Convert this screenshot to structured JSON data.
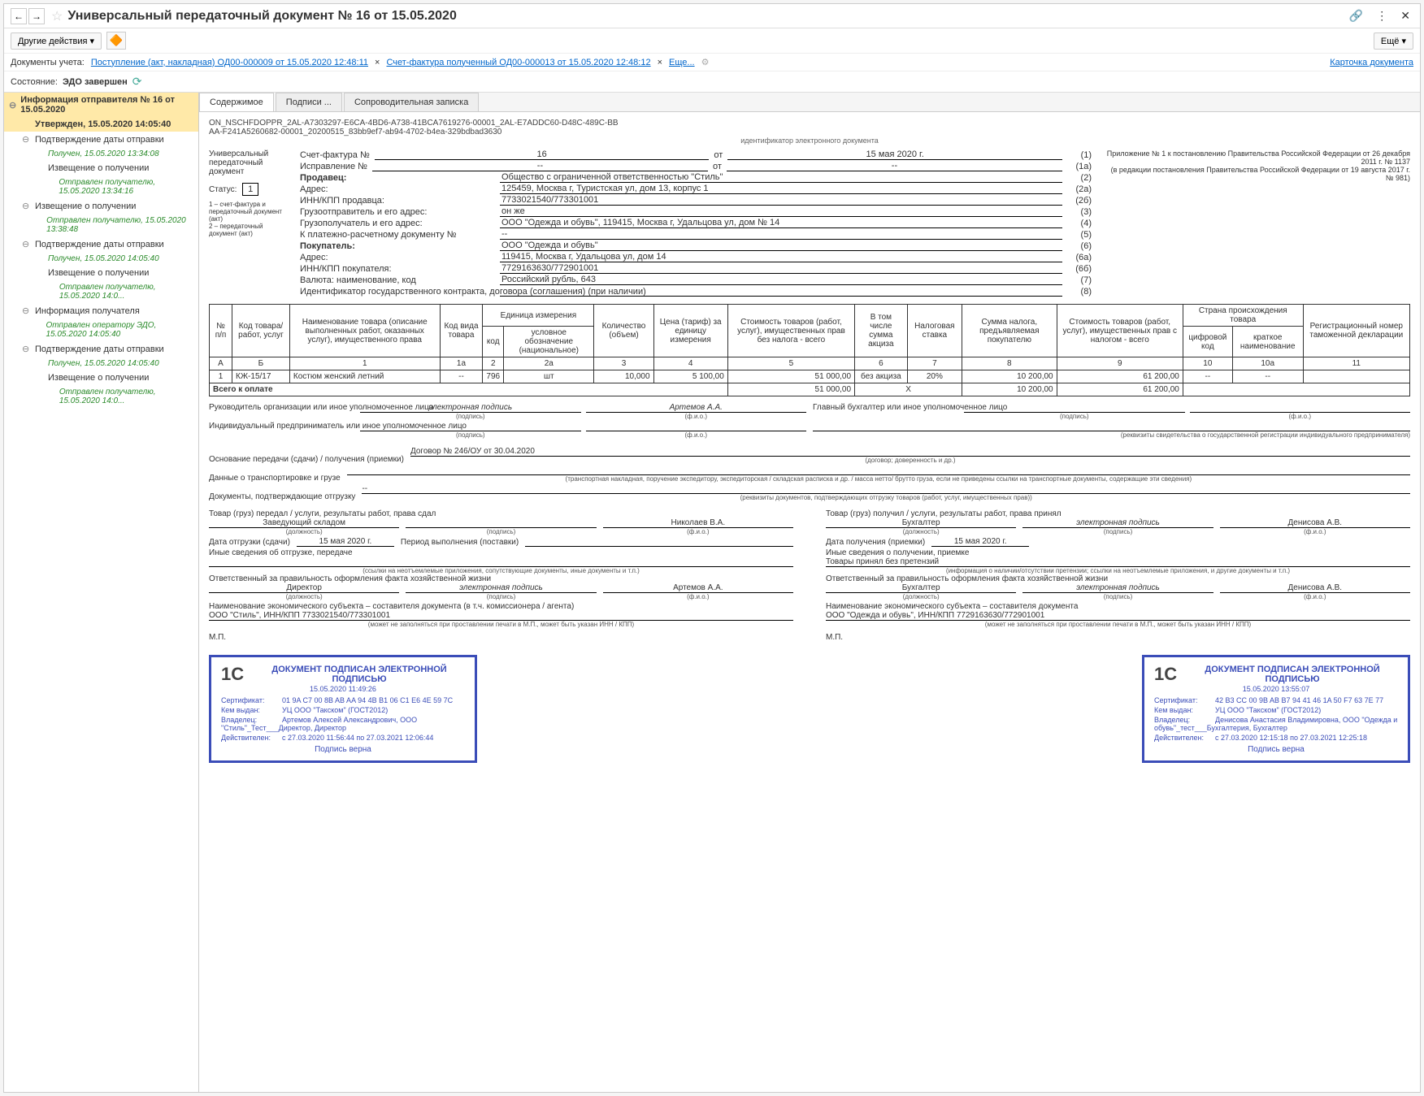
{
  "window": {
    "title": "Универсальный передаточный документ № 16 от 15.05.2020",
    "other_actions": "Другие действия",
    "more_btn": "Ещё"
  },
  "doc_links": {
    "label": "Документы учета:",
    "link1": "Поступление (акт, накладная) ОД00-000009 от 15.05.2020 12:48:11",
    "link2": "Счет-фактура полученный ОД00-000013 от 15.05.2020 12:48:12",
    "more": "Еще...",
    "card": "Карточка документа"
  },
  "state": {
    "label": "Состояние:",
    "value": "ЭДО завершен"
  },
  "sidebar": {
    "items": [
      {
        "text": "Информация отправителя № 16 от 15.05.2020",
        "type": "highlight",
        "exp": "⊖"
      },
      {
        "text": "Утвержден, 15.05.2020 14:05:40",
        "type": "highlight-sub"
      },
      {
        "text": "Подтверждение даты отправки",
        "type": "sub",
        "exp": "⊖"
      },
      {
        "text": "Получен, 15.05.2020 13:34:08",
        "type": "sub2 green"
      },
      {
        "text": "Извещение о получении",
        "type": "sub2"
      },
      {
        "text": "Отправлен получателю, 15.05.2020 13:34:16",
        "type": "sub3 green"
      },
      {
        "text": "Извещение о получении",
        "type": "sub",
        "exp": "⊖"
      },
      {
        "text": "Отправлен получателю, 15.05.2020 13:38:48",
        "type": "sub2 green"
      },
      {
        "text": "Подтверждение даты отправки",
        "type": "sub",
        "exp": "⊖"
      },
      {
        "text": "Получен, 15.05.2020 14:05:40",
        "type": "sub2 green"
      },
      {
        "text": "Извещение о получении",
        "type": "sub2"
      },
      {
        "text": "Отправлен получателю, 15.05.2020 14:0...",
        "type": "sub3 green"
      },
      {
        "text": "Информация получателя",
        "type": "sub",
        "exp": "⊖"
      },
      {
        "text": "Отправлен оператору ЭДО, 15.05.2020 14:05:40",
        "type": "sub2 green"
      },
      {
        "text": "Подтверждение даты отправки",
        "type": "sub",
        "exp": "⊖"
      },
      {
        "text": "Получен, 15.05.2020 14:05:40",
        "type": "sub2 green"
      },
      {
        "text": "Извещение о получении",
        "type": "sub2"
      },
      {
        "text": "Отправлен получателю, 15.05.2020 14:0...",
        "type": "sub3 green"
      }
    ]
  },
  "tabs": {
    "t1": "Содержимое",
    "t2": "Подписи ...",
    "t3": "Сопроводительная записка"
  },
  "doc_id": {
    "line1": "ON_NSCHFDOPPR_2AL-A7303297-E6CA-4BD6-A738-41BCA7619276-00001_2AL-E7ADDC60-D48C-489C-BB",
    "line2": "AA-F241A5260682-00001_20200515_83bb9ef7-ab94-4702-b4ea-329bdbad3630",
    "label": "идентификатор электронного документа"
  },
  "header": {
    "left_title": "Универсальный передаточный документ",
    "status_label": "Статус:",
    "status_value": "1",
    "footnote": "1 – счет-фактура и передаточный документ (акт)\n2 – передаточный документ (акт)",
    "annex": "Приложение № 1 к постановлению Правительства Российской Федерации от 26 декабря 2011 г. № 1137\n(в редакции постановления Правительства Российской Федерации от 19 августа 2017 г. № 981)",
    "invoice_label": "Счет-фактура №",
    "invoice_num": "16",
    "invoice_date_label": "от",
    "invoice_date": "15 мая 2020 г.",
    "invoice_paren": "(1)",
    "correction_label": "Исправление №",
    "correction_paren": "(1а)",
    "dash": "--",
    "rows": [
      {
        "label": "Продавец:",
        "val": "Общество с ограниченной ответственностью \"Стиль\"",
        "num": "(2)"
      },
      {
        "label": "Адрес:",
        "val": "125459, Москва г, Туристская ул, дом 13, корпус 1",
        "num": "(2а)"
      },
      {
        "label": "ИНН/КПП продавца:",
        "val": "7733021540/773301001",
        "num": "(2б)"
      },
      {
        "label": "Грузоотправитель и его адрес:",
        "val": "он же",
        "num": "(3)"
      },
      {
        "label": "Грузополучатель и его адрес:",
        "val": "ООО \"Одежда и обувь\", 119415, Москва г, Удальцова ул, дом № 14",
        "num": "(4)"
      },
      {
        "label": "К платежно-расчетному документу №",
        "val": "--",
        "num": "(5)"
      },
      {
        "label": "Покупатель:",
        "val": "ООО \"Одежда и обувь\"",
        "num": "(6)"
      },
      {
        "label": "Адрес:",
        "val": "119415, Москва г, Удальцова ул, дом 14",
        "num": "(6а)"
      },
      {
        "label": "ИНН/КПП покупателя:",
        "val": "7729163630/772901001",
        "num": "(6б)"
      },
      {
        "label": "Валюта: наименование, код",
        "val": "Российский рубль, 643",
        "num": "(7)"
      },
      {
        "label": "Идентификатор государственного контракта, договора (соглашения) (при наличии)",
        "val": "",
        "num": "(8)"
      }
    ]
  },
  "table": {
    "headers": {
      "h1": "№ п/п",
      "h2": "Код товара/ работ, услуг",
      "h3": "Наименование товара (описание выполненных работ, оказанных услуг), имущественного права",
      "h4": "Код вида товара",
      "h5": "Единица измерения",
      "h5a": "код",
      "h5b": "условное обозначение (национальное)",
      "h6": "Количество (объем)",
      "h7": "Цена (тариф) за единицу измерения",
      "h8": "Стоимость товаров (работ, услуг), имущественных прав без налога - всего",
      "h9": "В том числе сумма акциза",
      "h10": "Налоговая ставка",
      "h11": "Сумма налога, предъявляемая покупателю",
      "h12": "Стоимость товаров (работ, услуг), имущественных прав с налогом - всего",
      "h13": "Страна происхождения товара",
      "h13a": "цифровой код",
      "h13b": "краткое наименование",
      "h14": "Регистрационный номер таможенной декларации"
    },
    "cols": [
      "А",
      "Б",
      "1",
      "1а",
      "2",
      "2а",
      "3",
      "4",
      "5",
      "6",
      "7",
      "8",
      "9",
      "10",
      "10а",
      "11"
    ],
    "row1": {
      "n": "1",
      "code": "КЖ-15/17",
      "name": "Костюм женский летний",
      "kind": "--",
      "ucode": "796",
      "uname": "шт",
      "qty": "10,000",
      "price": "5 100,00",
      "sum": "51 000,00",
      "excise": "без акциза",
      "rate": "20%",
      "tax": "10 200,00",
      "total": "61 200,00",
      "ccode": "--",
      "cname": "--",
      "reg": ""
    },
    "totals": {
      "label": "Всего к оплате",
      "sum": "51 000,00",
      "x": "X",
      "tax": "10 200,00",
      "total": "61 200,00"
    }
  },
  "sig": {
    "ruk_label": "Руководитель организации или иное уполномоченное лицо",
    "ep": "электронная подпись",
    "podpis": "(подпись)",
    "fio": "(ф.и.о.)",
    "artemov": "Артемов А.А.",
    "glav_label": "Главный бухгалтер или иное уполномоченное лицо",
    "ip_label": "Индивидуальный предприниматель или иное уполномоченное лицо",
    "rekv": "(реквизиты свидетельства о государственной регистрации индивидуального предпринимателя)",
    "basis_label": "Основание передачи (сдачи) / получения (приемки)",
    "basis_val": "Договор № 246/ОУ от 30.04.2020",
    "basis_sub": "(договор; доверенность и др.)",
    "transport_label": "Данные о транспортировке и грузе",
    "transport_sub": "(транспортная накладная, поручение экспедитору, экспедиторская / складская расписка и др. / масса нетто/ брутто груза, если не приведены ссылки на транспортные документы, содержащие эти сведения)",
    "ship_docs_label": "Документы, подтверждающие отгрузку",
    "ship_docs_val": "--",
    "ship_docs_sub": "(реквизиты документов, подтверждающих отгрузку товаров (работ, услуг, имущественных прав))",
    "left_title": "Товар (груз) передал / услуги, результаты работ, права сдал",
    "left_pos": "Заведующий складом",
    "left_name": "Николаев В.А.",
    "dolzhnost": "(должность)",
    "ship_date_label": "Дата отгрузки (сдачи)",
    "ship_date": "15 мая 2020 г.",
    "period_label": "Период выполнения (поставки)",
    "other_info_left": "Иные сведения об отгрузке, передаче",
    "other_sub_left": "(ссылки на неотъемлемые приложения, сопутствующие документы, иные документы и т.п.)",
    "resp_left_label": "Ответственный за правильность оформления факта хозяйственной жизни",
    "resp_left_pos": "Директор",
    "resp_left_name": "Артемов А.А.",
    "econ_left_label": "Наименование экономического субъекта – составителя документа (в т.ч. комиссионера / агента)",
    "econ_left_val": "ООО \"Стиль\", ИНН/КПП 7733021540/773301001",
    "mp": "М.П.",
    "econ_sub": "(может не заполняться при проставлении печати в М.П., может быть указан ИНН / КПП)",
    "right_title": "Товар (груз) получил / услуги, результаты работ, права принял",
    "right_pos": "Бухгалтер",
    "right_name": "Денисова А.В.",
    "recv_date_label": "Дата получения (приемки)",
    "recv_date": "15 мая 2020 г.",
    "other_info_right": "Иные сведения о получении, приемке",
    "no_claims": "Товары принял без претензий",
    "other_sub_right": "(информация о наличии/отсутствии претензии; ссылки на неотъемлемые приложения, и другие документы и т.п.)",
    "resp_right_label": "Ответственный за правильность оформления факта хозяйственной жизни",
    "resp_right_pos": "Бухгалтер",
    "resp_right_name": "Денисова А.В.",
    "econ_right_label": "Наименование экономического субъекта – составителя документа",
    "econ_right_val": "ООО \"Одежда и обувь\", ИНН/КПП 7729163630/772901001"
  },
  "stamps": {
    "title": "ДОКУМЕНТ ПОДПИСАН ЭЛЕКТРОННОЙ ПОДПИСЬЮ",
    "logo": "1C",
    "cert_label": "Сертификат:",
    "issuer_label": "Кем выдан:",
    "owner_label": "Владелец:",
    "valid_label": "Действителен:",
    "verified": "Подпись верна",
    "left": {
      "date": "15.05.2020 11:49:26",
      "cert": "01 9A C7 00 8B AB AA 94 4B B1 06 C1 E6 4E 59 7C",
      "issuer": "УЦ ООО \"Такском\" (ГОСТ2012)",
      "owner": "Артемов Алексей Александрович, ООО \"Стиль\"_Тест___Директор, Директор",
      "valid": "c 27.03.2020 11:56:44 по 27.03.2021 12:06:44"
    },
    "right": {
      "date": "15.05.2020 13:55:07",
      "cert": "42 B3 CC 00 9B AB B7 94 41 46 1A 50 F7 63 7E 77",
      "issuer": "УЦ ООО \"Такском\" (ГОСТ2012)",
      "owner": "Денисова Анастасия Владимировна, ООО \"Одежда и обувь\"_тест___Бухгалтерия, Бухгалтер",
      "valid": "c 27.03.2020 12:15:18 по 27.03.2021 12:25:18"
    }
  }
}
